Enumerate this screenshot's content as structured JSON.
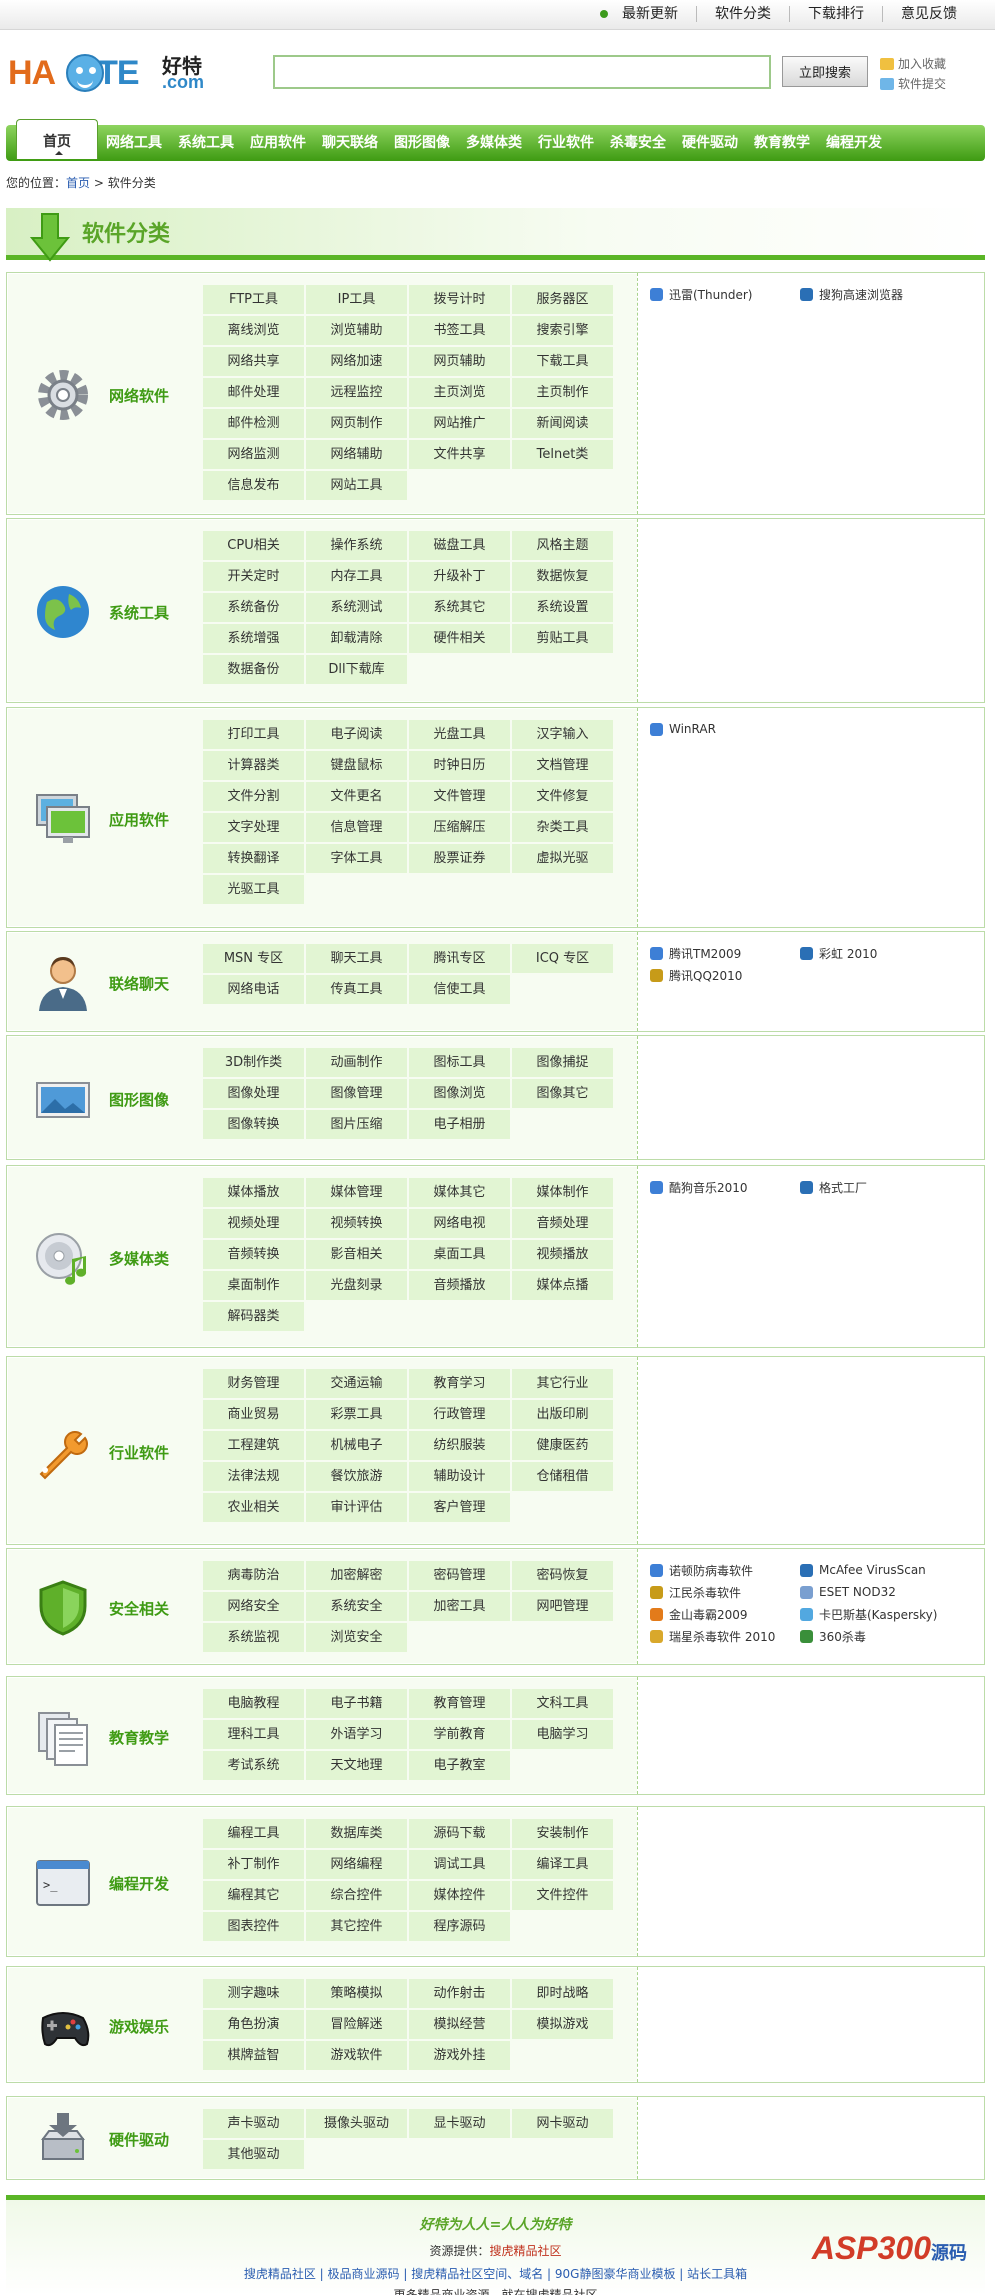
{
  "top_links": [
    "最新更新",
    "软件分类",
    "下载排行",
    "意见反馈"
  ],
  "logo": {
    "text_a": "HA",
    "text_b": "TE",
    "com": ".com",
    "cn": "好特"
  },
  "search": {
    "value": "",
    "button": "立即搜索"
  },
  "header_links": [
    "加入收藏",
    "软件提交"
  ],
  "nav": [
    "首页",
    "网络工具",
    "系统工具",
    "应用软件",
    "聊天联络",
    "图形图像",
    "多媒体类",
    "行业软件",
    "杀毒安全",
    "硬件驱动",
    "教育教学",
    "编程开发"
  ],
  "breadcrumb": {
    "prefix": "您的位置：",
    "home": "首页",
    "sep": ">",
    "current": "软件分类"
  },
  "section_title": "软件分类",
  "categories": [
    {
      "name": "网络软件",
      "icon": "gear-icon",
      "items": [
        "FTP工具",
        "IP工具",
        "拨号计时",
        "服务器区",
        "离线浏览",
        "浏览辅助",
        "书签工具",
        "搜索引擎",
        "网络共享",
        "网络加速",
        "网页辅助",
        "下载工具",
        "邮件处理",
        "远程监控",
        "主页浏览",
        "主页制作",
        "邮件检测",
        "网页制作",
        "网站推广",
        "新闻阅读",
        "网络监测",
        "网络辅助",
        "文件共享",
        "Telnet类",
        "信息发布",
        "网站工具"
      ],
      "apps": [
        "迅雷(Thunder)",
        "搜狗高速浏览器"
      ]
    },
    {
      "name": "系统工具",
      "icon": "globe-icon",
      "items": [
        "CPU相关",
        "操作系统",
        "磁盘工具",
        "风格主题",
        "开关定时",
        "内存工具",
        "升级补丁",
        "数据恢复",
        "系统备份",
        "系统测试",
        "系统其它",
        "系统设置",
        "系统增强",
        "卸载清除",
        "硬件相关",
        "剪贴工具",
        "数据备份",
        "Dll下载库"
      ],
      "apps": []
    },
    {
      "name": "应用软件",
      "icon": "monitor-icon",
      "items": [
        "打印工具",
        "电子阅读",
        "光盘工具",
        "汉字输入",
        "计算器类",
        "键盘鼠标",
        "时钟日历",
        "文档管理",
        "文件分割",
        "文件更名",
        "文件管理",
        "文件修复",
        "文字处理",
        "信息管理",
        "压缩解压",
        "杂类工具",
        "转换翻译",
        "字体工具",
        "股票证券",
        "虚拟光驱",
        "光驱工具"
      ],
      "apps": [
        "WinRAR"
      ]
    },
    {
      "name": "联络聊天",
      "icon": "user-icon",
      "items": [
        "MSN 专区",
        "聊天工具",
        "腾讯专区",
        "ICQ 专区",
        "网络电话",
        "传真工具",
        "信使工具"
      ],
      "apps": [
        "腾讯TM2009",
        "彩虹 2010",
        "腾讯QQ2010"
      ]
    },
    {
      "name": "图形图像",
      "icon": "picture-icon",
      "items": [
        "3D制作类",
        "动画制作",
        "图标工具",
        "图像捕捉",
        "图像处理",
        "图像管理",
        "图像浏览",
        "图像其它",
        "图像转换",
        "图片压缩",
        "电子相册"
      ],
      "apps": []
    },
    {
      "name": "多媒体类",
      "icon": "cd-music-icon",
      "items": [
        "媒体播放",
        "媒体管理",
        "媒体其它",
        "媒体制作",
        "视频处理",
        "视频转换",
        "网络电视",
        "音频处理",
        "音频转换",
        "影音相关",
        "桌面工具",
        "视频播放",
        "桌面制作",
        "光盘刻录",
        "音频播放",
        "媒体点播",
        "解码器类"
      ],
      "apps": [
        "酷狗音乐2010",
        "格式工厂"
      ]
    },
    {
      "name": "行业软件",
      "icon": "wrench-icon",
      "items": [
        "财务管理",
        "交通运输",
        "教育学习",
        "其它行业",
        "商业贸易",
        "彩票工具",
        "行政管理",
        "出版印刷",
        "工程建筑",
        "机械电子",
        "纺织服装",
        "健康医药",
        "法律法规",
        "餐饮旅游",
        "辅助设计",
        "仓储租借",
        "农业相关",
        "审计评估",
        "客户管理"
      ],
      "apps": []
    },
    {
      "name": "安全相关",
      "icon": "shield-icon",
      "items": [
        "病毒防治",
        "加密解密",
        "密码管理",
        "密码恢复",
        "网络安全",
        "系统安全",
        "加密工具",
        "网吧管理",
        "系统监视",
        "浏览安全"
      ],
      "apps": [
        "诺顿防病毒软件",
        "McAfee VirusScan",
        "江民杀毒软件",
        "ESET NOD32",
        "金山毒霸2009",
        "卡巴斯基(Kaspersky)",
        "瑞星杀毒软件 2010",
        "360杀毒"
      ]
    },
    {
      "name": "教育教学",
      "icon": "documents-icon",
      "items": [
        "电脑教程",
        "电子书籍",
        "教育管理",
        "文科工具",
        "理科工具",
        "外语学习",
        "学前教育",
        "电脑学习",
        "考试系统",
        "天文地理",
        "电子教室"
      ],
      "apps": []
    },
    {
      "name": "编程开发",
      "icon": "terminal-icon",
      "items": [
        "编程工具",
        "数据库类",
        "源码下载",
        "安装制作",
        "补丁制作",
        "网络编程",
        "调试工具",
        "编译工具",
        "编程其它",
        "综合控件",
        "媒体控件",
        "文件控件",
        "图表控件",
        "其它控件",
        "程序源码"
      ],
      "apps": []
    },
    {
      "name": "游戏娱乐",
      "icon": "gamepad-icon",
      "items": [
        "测字趣味",
        "策略模拟",
        "动作射击",
        "即时战略",
        "角色扮演",
        "冒险解迷",
        "模拟经营",
        "模拟游戏",
        "棋牌益智",
        "游戏软件",
        "游戏外挂"
      ],
      "apps": []
    },
    {
      "name": "硬件驱动",
      "icon": "harddisk-icon",
      "items": [
        "声卡驱动",
        "摄像头驱动",
        "显卡驱动",
        "网卡驱动",
        "其他驱动"
      ],
      "apps": []
    }
  ],
  "footer": {
    "slogan": "好特为人人=人人为好特",
    "resource_label": "资源提供：",
    "resource_name": "搜虎精品社区",
    "links": "搜虎精品社区 | 极品商业源码 | 搜虎精品社区空间、域名 | 90G静图豪华商业模板 | 站长工具箱",
    "more": "更多精品商业资源，就在搜虎精品社区",
    "badge_a": "ASP300",
    "badge_b": "源码"
  },
  "colors": {
    "brand_green": "#3f9b14",
    "cell_bg": "#e2f5d3",
    "panel_bg": "#f7fcf2"
  }
}
